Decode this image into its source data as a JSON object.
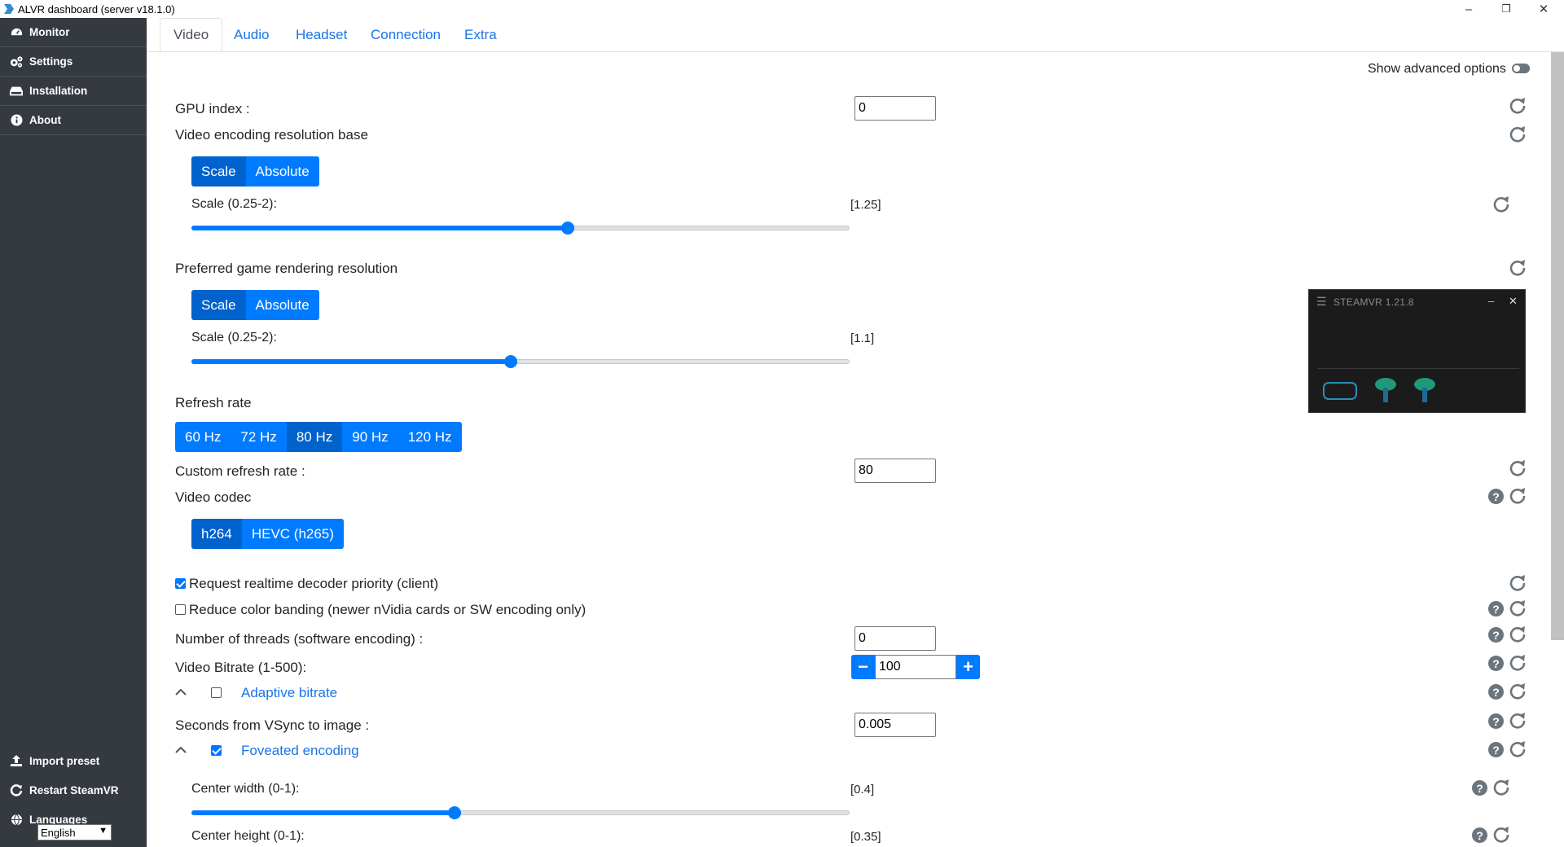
{
  "window": {
    "title": "ALVR dashboard (server v18.1.0)",
    "minimize": "–",
    "maximize": "❐",
    "close": "✕"
  },
  "sidebar": {
    "items": [
      {
        "label": "Monitor",
        "icon": "speedometer-icon"
      },
      {
        "label": "Settings",
        "icon": "gears-icon"
      },
      {
        "label": "Installation",
        "icon": "hdd-icon"
      },
      {
        "label": "About",
        "icon": "info-circle-icon"
      }
    ],
    "bottom": [
      {
        "label": "Import preset",
        "icon": "upload-icon"
      },
      {
        "label": "Restart SteamVR",
        "icon": "restart-icon"
      },
      {
        "label": "Languages",
        "icon": "globe-icon"
      }
    ],
    "language": "English"
  },
  "tabs": [
    {
      "label": "Video",
      "active": true
    },
    {
      "label": "Audio"
    },
    {
      "label": "Headset"
    },
    {
      "label": "Connection"
    },
    {
      "label": "Extra"
    }
  ],
  "advanced": {
    "label": "Show advanced options",
    "enabled": true
  },
  "settings": {
    "gpu_index": {
      "label": "GPU index :",
      "value": "0"
    },
    "encoding_res": {
      "label": "Video encoding resolution base",
      "options": [
        "Scale",
        "Absolute"
      ],
      "selected": "Scale"
    },
    "encoding_scale": {
      "label": "Scale (0.25-2):",
      "value": "[1.25]",
      "min": 0.25,
      "max": 2,
      "current": 1.25
    },
    "game_res": {
      "label": "Preferred game rendering resolution",
      "options": [
        "Scale",
        "Absolute"
      ],
      "selected": "Scale"
    },
    "game_scale": {
      "label": "Scale (0.25-2):",
      "value": "[1.1]",
      "min": 0.25,
      "max": 2,
      "current": 1.1
    },
    "refresh_rate": {
      "label": "Refresh rate",
      "options": [
        "60 Hz",
        "72 Hz",
        "80 Hz",
        "90 Hz",
        "120 Hz"
      ],
      "selected": "80 Hz"
    },
    "custom_refresh": {
      "label": "Custom refresh rate :",
      "value": "80"
    },
    "codec": {
      "label": "Video codec",
      "options": [
        "h264",
        "HEVC (h265)"
      ],
      "selected": "h264"
    },
    "realtime_priority": {
      "label": "Request realtime decoder priority (client)",
      "checked": true
    },
    "color_banding": {
      "label": "Reduce color banding (newer nVidia cards or SW encoding only)",
      "checked": false
    },
    "threads": {
      "label": "Number of threads (software encoding) :",
      "value": "0"
    },
    "bitrate": {
      "label": "Video Bitrate (1-500):",
      "value": "100",
      "minus": "−",
      "plus": "+"
    },
    "adaptive_bitrate": {
      "label": "Adaptive bitrate",
      "checked": false
    },
    "vsync": {
      "label": "Seconds from VSync to image :",
      "value": "0.005"
    },
    "foveated": {
      "label": "Foveated encoding",
      "checked": true
    },
    "center_width": {
      "label": "Center width (0-1):",
      "value": "[0.4]",
      "min": 0,
      "max": 1,
      "current": 0.4
    },
    "center_height": {
      "label": "Center height (0-1):",
      "value": "[0.35]"
    }
  },
  "steamvr": {
    "title": "STEAMVR 1.21.8",
    "minimize": "–",
    "close": "✕"
  },
  "colors": {
    "accent": "#007bff",
    "sidebar": "#343a40"
  }
}
